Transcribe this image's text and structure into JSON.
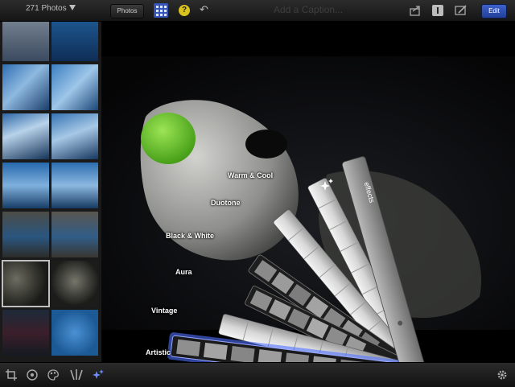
{
  "toolbar": {
    "photo_count": "271 Photos",
    "photos_button": "Photos",
    "help_glyph": "?",
    "caption_placeholder": "Add a Caption...",
    "edit_button": "Edit"
  },
  "effects": {
    "panel_label": "effects",
    "presets": [
      "Warm & Cool",
      "Duotone",
      "Black & White",
      "Aura",
      "Vintage",
      "Artistic"
    ],
    "selected": "Artistic"
  },
  "icons": {
    "topbar": [
      "share-icon",
      "info-icon",
      "edit-meta-icon"
    ],
    "bottombar": [
      "crop-icon",
      "exposure-icon",
      "color-palette-icon",
      "brushes-icon",
      "effects-icon",
      "settings-gear-icon"
    ]
  },
  "colors": {
    "accent_blue": "#3554b8",
    "selected_glow": "#4f6fff",
    "help_yellow": "#d9c21c",
    "sphere_green": "#6fd02a"
  }
}
